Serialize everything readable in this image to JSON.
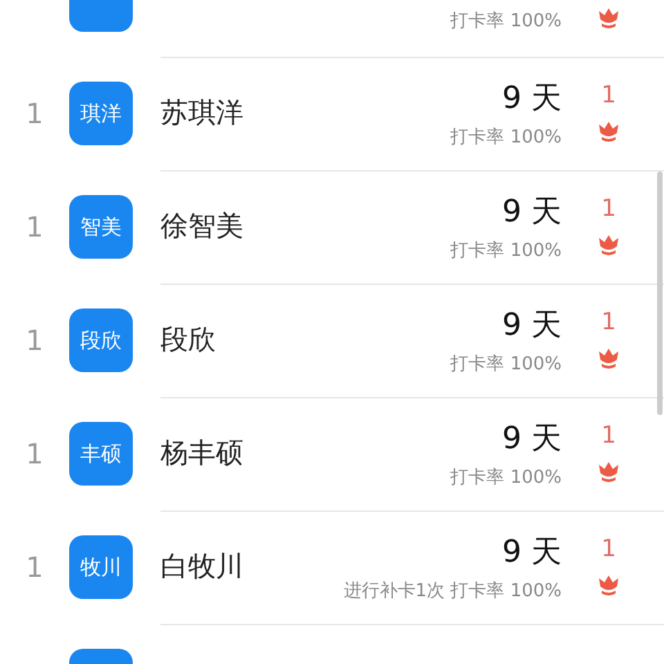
{
  "rows": [
    {
      "note": "打卡率 100%"
    },
    {
      "rank": "1",
      "avatar": "琪洋",
      "name": "苏琪洋",
      "days": "9 天",
      "note": "打卡率 100%",
      "count": "1"
    },
    {
      "rank": "1",
      "avatar": "智美",
      "name": "徐智美",
      "days": "9 天",
      "note": "打卡率 100%",
      "count": "1"
    },
    {
      "rank": "1",
      "avatar": "段欣",
      "name": "段欣",
      "days": "9 天",
      "note": "打卡率 100%",
      "count": "1"
    },
    {
      "rank": "1",
      "avatar": "丰硕",
      "name": "杨丰硕",
      "days": "9 天",
      "note": "打卡率 100%",
      "count": "1"
    },
    {
      "rank": "1",
      "avatar": "牧川",
      "name": "白牧川",
      "days": "9 天",
      "note": "进行补卡1次 打卡率 100%",
      "count": "1"
    },
    {}
  ]
}
